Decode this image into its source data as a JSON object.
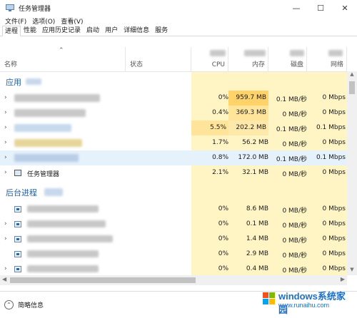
{
  "window": {
    "title": "任务管理器",
    "minimize_glyph": "—",
    "maximize_glyph": "☐",
    "close_glyph": "✕"
  },
  "menu": [
    "文件(F)",
    "选项(O)",
    "查看(V)"
  ],
  "tabs": [
    "进程",
    "性能",
    "应用历史记录",
    "启动",
    "用户",
    "详细信息",
    "服务"
  ],
  "active_tab": "进程",
  "columns": {
    "name": "名称",
    "status": "状态",
    "cpu": "CPU",
    "memory": "内存",
    "disk": "磁盘",
    "network": "网络"
  },
  "sections": {
    "apps": "应用",
    "background": "后台进程"
  },
  "app_rows": [
    {
      "name": "",
      "cpu": "0%",
      "memory": "959.7 MB",
      "disk": "0.1 MB/秒",
      "network": "0 Mbps"
    },
    {
      "name": "",
      "cpu": "0.4%",
      "memory": "369.3 MB",
      "disk": "0 MB/秒",
      "network": "0 Mbps"
    },
    {
      "name": "",
      "cpu": "5.5%",
      "memory": "202.2 MB",
      "disk": "0.1 MB/秒",
      "network": "0.1 Mbps"
    },
    {
      "name": "",
      "cpu": "1.7%",
      "memory": "56.2 MB",
      "disk": "0 MB/秒",
      "network": "0 Mbps"
    },
    {
      "name": "",
      "cpu": "0.8%",
      "memory": "172.0 MB",
      "disk": "0.1 MB/秒",
      "network": "0.1 Mbps"
    },
    {
      "name": "任务管理器",
      "cpu": "2.1%",
      "memory": "32.1 MB",
      "disk": "0 MB/秒",
      "network": "0 Mbps"
    }
  ],
  "background_rows": [
    {
      "cpu": "0%",
      "memory": "8.6 MB",
      "disk": "0 MB/秒",
      "network": "0 Mbps"
    },
    {
      "cpu": "0%",
      "memory": "0.1 MB",
      "disk": "0 MB/秒",
      "network": "0 Mbps"
    },
    {
      "cpu": "0%",
      "memory": "1.4 MB",
      "disk": "0 MB/秒",
      "network": "0 Mbps"
    },
    {
      "cpu": "0%",
      "memory": "2.9 MB",
      "disk": "0 MB/秒",
      "network": "0 Mbps"
    },
    {
      "cpu": "0%",
      "memory": "0.4 MB",
      "disk": "0 MB/秒",
      "network": "0 Mbps"
    }
  ],
  "footer": {
    "collapse_label": "简略信息",
    "collapse_glyph": "⌃"
  },
  "watermark": {
    "text": "windows系统家园",
    "url": "www.runaihu.com"
  },
  "colors": {
    "section_title": "#1f5ea8",
    "heat_low": "#fff4c4",
    "heat_high": "#ffd26a",
    "selected_row": "#e5f1fb"
  }
}
